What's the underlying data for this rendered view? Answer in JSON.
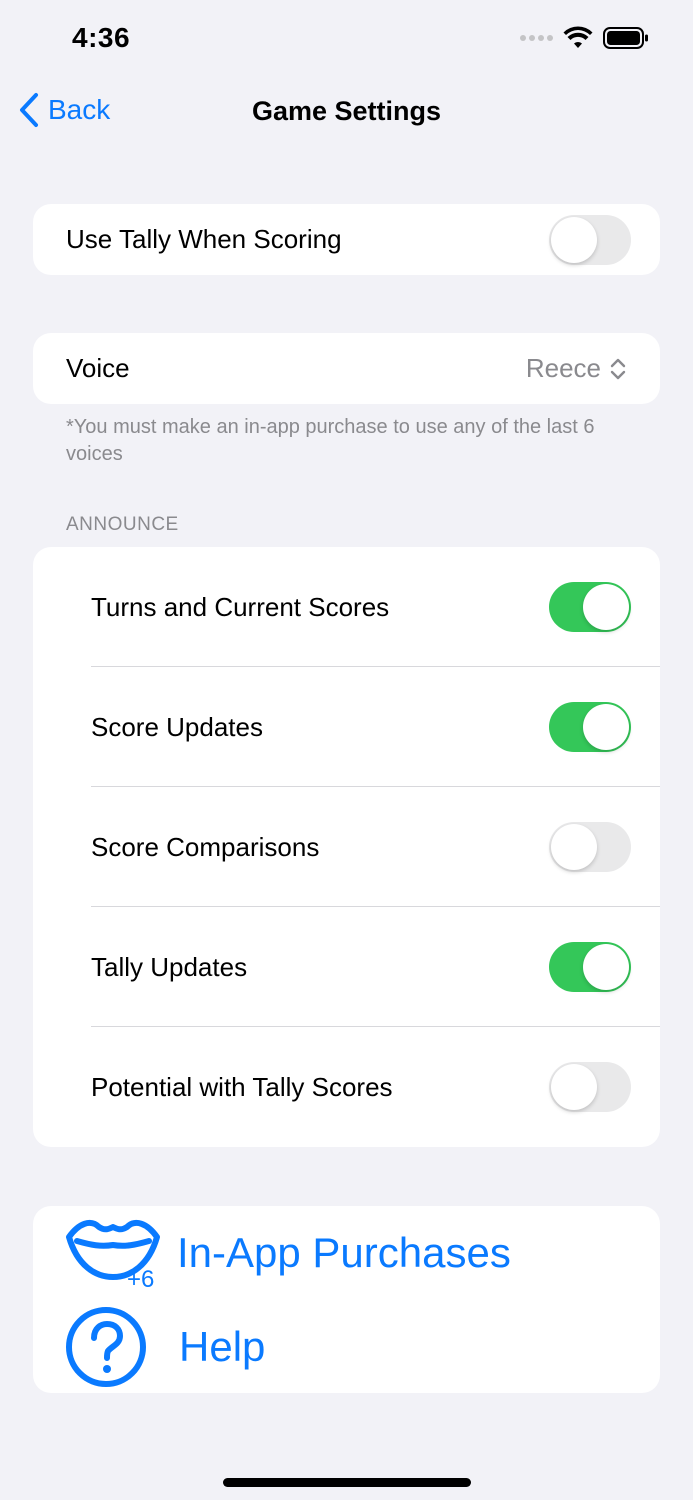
{
  "status_bar": {
    "time": "4:36",
    "icons": [
      "cellular-dots-icon",
      "wifi-icon",
      "battery-icon"
    ]
  },
  "nav": {
    "back_label": "Back",
    "title": "Game Settings"
  },
  "tally_card": {
    "label": "Use Tally When Scoring",
    "enabled": false
  },
  "voice_card": {
    "label": "Voice",
    "value": "Reece",
    "footnote": "*You must make an in-app purchase to use any of the last 6 voices"
  },
  "announce": {
    "header": "ANNOUNCE",
    "items": [
      {
        "label": "Turns and Current Scores",
        "enabled": true
      },
      {
        "label": "Score Updates",
        "enabled": true
      },
      {
        "label": "Score Comparisons",
        "enabled": false
      },
      {
        "label": "Tally Updates",
        "enabled": true
      },
      {
        "label": "Potential with Tally Scores",
        "enabled": false
      }
    ]
  },
  "links": {
    "purchases_label": "In-App Purchases",
    "purchases_badge": "+6",
    "help_label": "Help"
  },
  "colors": {
    "accent": "#0A7AFF",
    "toggle_on": "#34C759",
    "toggle_off": "#E9E9EA",
    "background": "#F2F2F7"
  }
}
